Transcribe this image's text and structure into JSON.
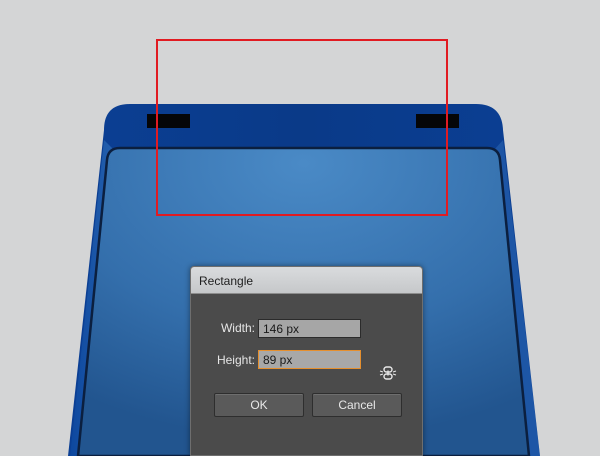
{
  "dialog": {
    "title": "Rectangle",
    "width": {
      "label": "Width:",
      "value": "146 px"
    },
    "height": {
      "label": "Height:",
      "value": "89 px"
    },
    "constrain_icon": "link-chain-icon",
    "ok_label": "OK",
    "cancel_label": "Cancel"
  },
  "colors": {
    "canvas_background": "#d4d5d6",
    "device_blue_top": "#0a3e96",
    "device_blue_screen": "#3f7fbc",
    "selection_outline": "#e11b22",
    "dialog_background": "#4a4a4a",
    "active_field_border": "#e58f2e"
  }
}
